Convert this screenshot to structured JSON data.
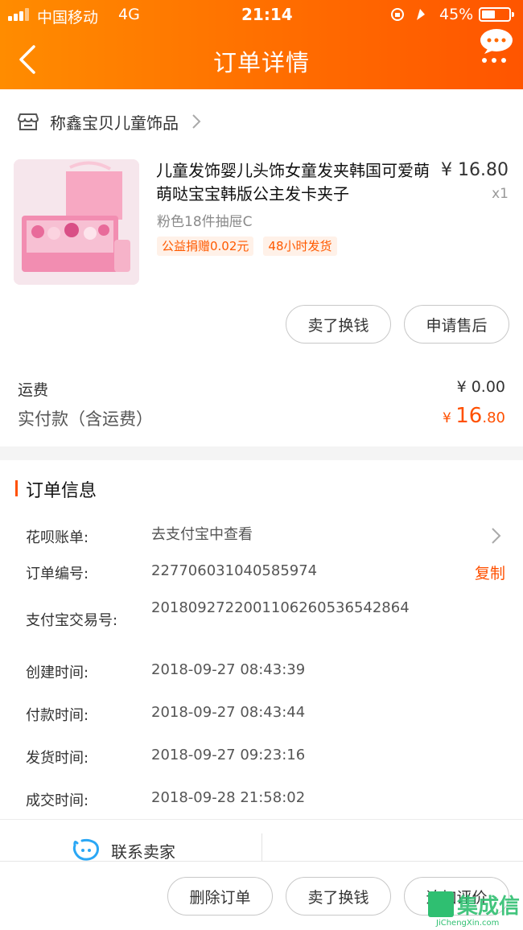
{
  "status_bar": {
    "carrier": "中国移动",
    "network": "4G",
    "time": "21:14",
    "battery": "45%"
  },
  "nav": {
    "title": "订单详情",
    "icons": [
      "back-arrow-icon",
      "more-chat-icon"
    ]
  },
  "shop": {
    "name": "称鑫宝贝儿童饰品",
    "icon": "store-icon"
  },
  "product": {
    "title": "儿童发饰婴儿头饰女童发夹韩国可爱萌萌哒宝宝韩版公主发卡夹子",
    "price": "¥ 16.80",
    "quantity": "x1",
    "spec": "粉色18件抽屉C",
    "tags": [
      "公益捐赠0.02元",
      "48小时发货"
    ]
  },
  "product_actions": [
    "卖了换钱",
    "申请售后"
  ],
  "fees": {
    "shipping_label": "运费",
    "shipping_value": "¥ 0.00",
    "total_label": "实付款（含运费）",
    "total_currency": "¥ ",
    "total_int": "16",
    "total_dec": ".80"
  },
  "order_info": {
    "section_title": "订单信息",
    "rows": [
      {
        "label": "花呗账单:",
        "value": "去支付宝中查看"
      },
      {
        "label": "订单编号:",
        "value": "227706031040585974"
      },
      {
        "label": "支付宝交易号:",
        "value": "2018092722001106260536542864"
      },
      {
        "label": "创建时间:",
        "value": "2018-09-27 08:43:39"
      },
      {
        "label": "付款时间:",
        "value": "2018-09-27 08:43:44"
      },
      {
        "label": "发货时间:",
        "value": "2018-09-27 09:23:16"
      },
      {
        "label": "成交时间:",
        "value": "2018-09-28 21:58:02"
      }
    ],
    "copy_label": "复制"
  },
  "contact": {
    "label": "联系卖家"
  },
  "bottom_actions": [
    "删除订单",
    "卖了换钱",
    "追加评价"
  ],
  "watermark": {
    "chinese": "集成信",
    "english": "JiChengXin.com"
  },
  "colors": {
    "accent": "#ff5000",
    "header_start": "#ff8c00",
    "header_end": "#ff5500"
  }
}
